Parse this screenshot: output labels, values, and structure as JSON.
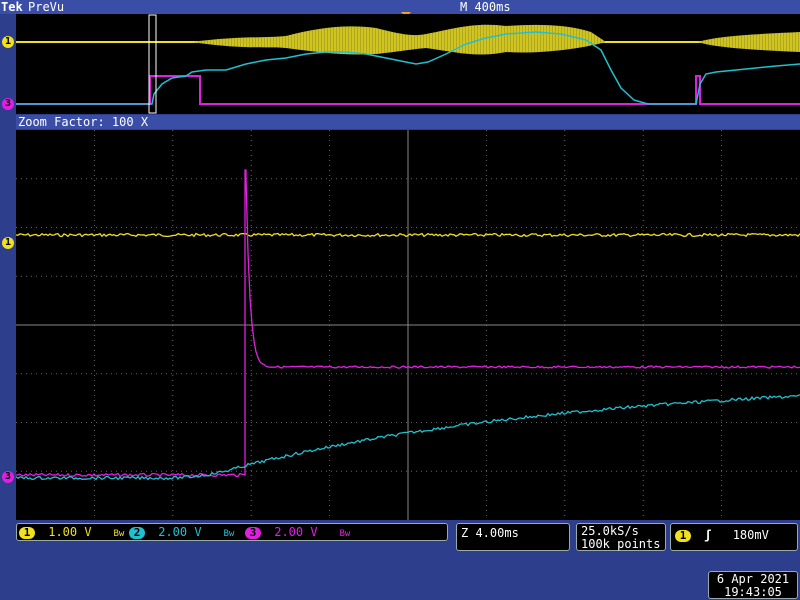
{
  "header": {
    "brand": "Tek",
    "mode": "PreVu",
    "timebase": "M 400ms"
  },
  "zoom": {
    "label": "Zoom Factor: 100 X"
  },
  "channels": [
    {
      "id": "1",
      "scale": "1.00 V",
      "color": "#f0e020"
    },
    {
      "id": "2",
      "scale": "2.00 V",
      "color": "#20c0d0"
    },
    {
      "id": "3",
      "scale": "2.00 V",
      "color": "#e020e0"
    }
  ],
  "bw_symbol": "Bw",
  "horizontal": {
    "zoom_scale": "Z 4.00ms"
  },
  "acquisition": {
    "sample_rate": "25.0kS/s",
    "record_length": "100k points"
  },
  "trigger": {
    "source": "1",
    "slope_symbol": "ʃ",
    "level": "180mV"
  },
  "datetime": {
    "date": "6 Apr  2021",
    "time": "19:43:05"
  },
  "colors": {
    "ch1": "#f0e020",
    "ch2": "#20c0d0",
    "ch3": "#e020e0",
    "grid": "#777777",
    "trigger_marker": "#f0a020"
  }
}
